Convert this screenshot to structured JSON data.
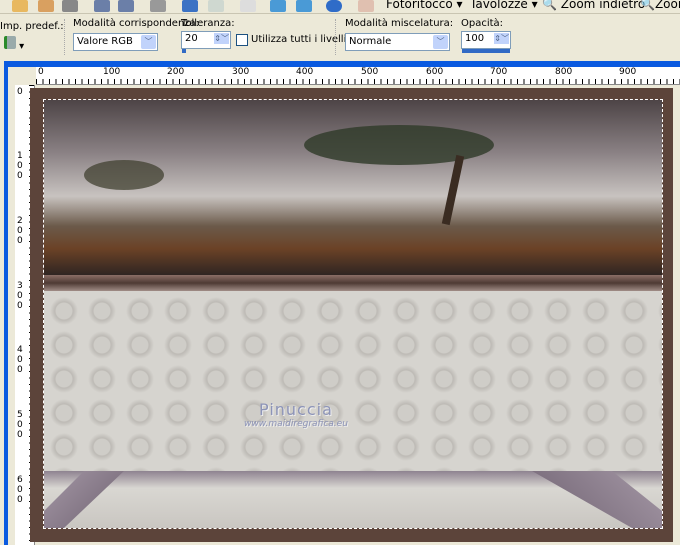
{
  "toolbar": {
    "menus": [
      {
        "label": "Fotoritocco"
      },
      {
        "label": "Tavolozze"
      }
    ],
    "zoom_out": "Zoom indietro",
    "zoom_in": "Zoom"
  },
  "options": {
    "preset_label": "Imp. predef.:",
    "match_mode_label": "Modalità corrispondenza:",
    "match_mode_value": "Valore RGB",
    "tolerance_label": "Tolleranza:",
    "tolerance_value": "20",
    "use_all_layers_label": "Utilizza tutti i livelli",
    "use_all_layers_checked": false,
    "blend_mode_label": "Modalità miscelatura:",
    "blend_mode_value": "Normale",
    "opacity_label": "Opacità:",
    "opacity_value": "100"
  },
  "rulers": {
    "horizontal": [
      "0",
      "100",
      "200",
      "300",
      "400",
      "500",
      "600",
      "700",
      "800",
      "900"
    ],
    "vertical": [
      "0",
      "100",
      "200",
      "300",
      "400",
      "500",
      "600"
    ]
  },
  "canvas": {
    "watermark_name": "Pinuccia",
    "watermark_url": "www.maidiregrafica.eu",
    "frame_color": "#5c443a"
  }
}
